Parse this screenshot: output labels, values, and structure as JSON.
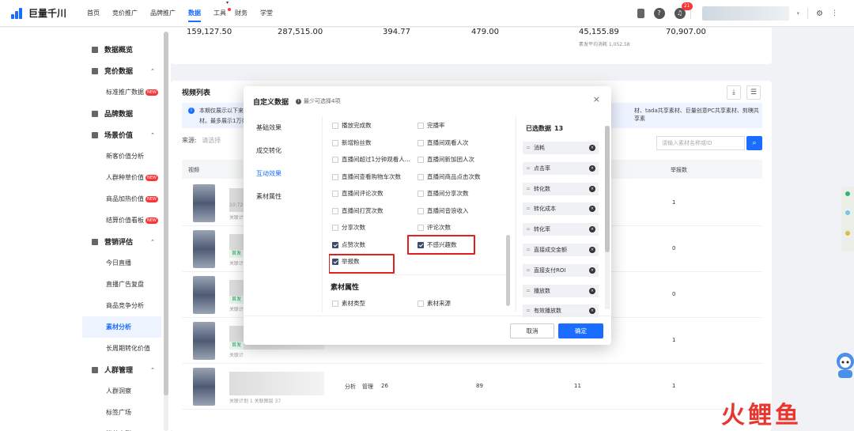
{
  "app": {
    "logo_text": "巨量千川"
  },
  "nav": [
    {
      "label": "首页"
    },
    {
      "label": "竞价推广"
    },
    {
      "label": "品牌推广"
    },
    {
      "label": "数据"
    },
    {
      "label": "工具"
    },
    {
      "label": "财务"
    },
    {
      "label": "学堂"
    }
  ],
  "header": {
    "notification_count": "21"
  },
  "sidebar": {
    "items": [
      {
        "label": "数据概览",
        "type": "group"
      },
      {
        "label": "竞价数据",
        "type": "group"
      },
      {
        "label": "标准推广数据",
        "type": "item",
        "new": true
      },
      {
        "label": "品牌数据",
        "type": "group"
      },
      {
        "label": "场景价值",
        "type": "group"
      },
      {
        "label": "新客价值分析",
        "type": "item"
      },
      {
        "label": "人群种草价值",
        "type": "item",
        "new": true
      },
      {
        "label": "商品加热价值",
        "type": "item",
        "new": true
      },
      {
        "label": "结算价值看板",
        "type": "item",
        "new": true
      },
      {
        "label": "营销评估",
        "type": "group"
      },
      {
        "label": "今日直播",
        "type": "item"
      },
      {
        "label": "直播广告复盘",
        "type": "item"
      },
      {
        "label": "商品竞争分析",
        "type": "item"
      },
      {
        "label": "素材分析",
        "type": "item",
        "active": true
      },
      {
        "label": "长周期转化价值",
        "type": "item"
      },
      {
        "label": "人群管理",
        "type": "group"
      },
      {
        "label": "人群洞察",
        "type": "item"
      },
      {
        "label": "标签广场",
        "type": "item"
      },
      {
        "label": "粉丝人群",
        "type": "item"
      }
    ],
    "new_tag": "NEW"
  },
  "stats": {
    "values": [
      "159,127.50",
      "287,515.00",
      "394.77",
      "479.00",
      "45,155.89",
      "70,907.00"
    ],
    "sub": "素发平均消耗 1,052.58"
  },
  "video_list": {
    "title": "视频列表",
    "info_prefix": "本期仅展示以下来",
    "info_line2": "材。最多展示1万条",
    "info_right": "材、tada共享素材、巨量创意PC共享素材、剪映共享素",
    "source_label": "来源:",
    "source_placeholder": "请选择",
    "search_placeholder": "请输入素材名称或ID",
    "col_video": "视频",
    "col_report": "举报数",
    "rows": [
      {
        "time": "10:72",
        "sub": "关联计",
        "report": "1",
        "tag": ""
      },
      {
        "time": "",
        "sub": "关联计",
        "report": "0",
        "tag": "首发"
      },
      {
        "time": "",
        "sub": "关联计",
        "report": "0",
        "tag": "首发"
      },
      {
        "time": "",
        "sub": "关联计",
        "report": "1",
        "tag": "首发"
      },
      {
        "time": "",
        "sub": "关联计划 1 关联图层 37",
        "report": "1",
        "tag": "",
        "analysis": "分析",
        "manage": "管理",
        "c1": "26",
        "c2": "89",
        "c3": "11"
      }
    ]
  },
  "modal": {
    "title": "自定义数据",
    "hint": "最少可选择4项",
    "nav": [
      "基础效果",
      "成交转化",
      "互动效果",
      "素材属性"
    ],
    "active_nav": 2,
    "checkboxes": [
      {
        "label": "播放完成数",
        "checked": false
      },
      {
        "label": "完播率",
        "checked": false
      },
      {
        "label": "新增粉丝数",
        "checked": false
      },
      {
        "label": "直播间观看人次",
        "checked": false
      },
      {
        "label": "直播间超过1分钟观看人...",
        "checked": false
      },
      {
        "label": "直播间新加团人次",
        "checked": false
      },
      {
        "label": "直播间查看购物车次数",
        "checked": false
      },
      {
        "label": "直播间商品点击次数",
        "checked": false
      },
      {
        "label": "直播间评论次数",
        "checked": false
      },
      {
        "label": "直播间分享次数",
        "checked": false
      },
      {
        "label": "直播间打赏次数",
        "checked": false
      },
      {
        "label": "直播间音浪收入",
        "checked": false
      },
      {
        "label": "分享次数",
        "checked": false
      },
      {
        "label": "评论次数",
        "checked": false
      },
      {
        "label": "点赞次数",
        "checked": true
      },
      {
        "label": "不感兴趣数",
        "checked": true
      },
      {
        "label": "举报数",
        "checked": true
      }
    ],
    "section2_title": "素材属性",
    "section2_items": [
      {
        "label": "素材类型",
        "checked": false
      },
      {
        "label": "素材来源",
        "checked": false
      }
    ],
    "selected_title": "已选数据",
    "selected_count": "13",
    "selected": [
      "消耗",
      "点击率",
      "转化数",
      "转化成本",
      "转化率",
      "直接成交金额",
      "直接支付ROI",
      "播放数",
      "有效播放数"
    ],
    "cancel": "取消",
    "ok": "确定"
  },
  "watermark": "火鲤鱼",
  "colors": {
    "primary": "#1a6dff",
    "highlight": "#e41f1f",
    "checked": "#3c4a6a"
  }
}
